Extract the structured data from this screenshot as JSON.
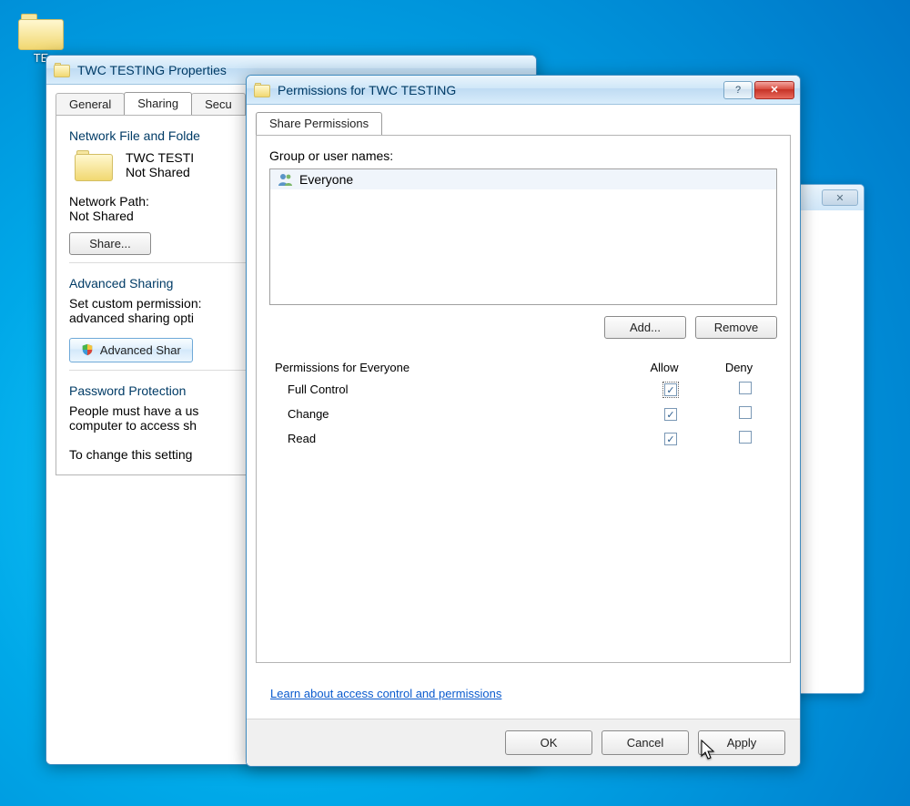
{
  "desktop": {
    "icon_label": "TE"
  },
  "properties_window": {
    "title": "TWC TESTING Properties",
    "tabs": {
      "general": "General",
      "sharing": "Sharing",
      "security": "Secu"
    },
    "section_network": "Network File and Folde",
    "folder_name": "TWC TESTI",
    "folder_status": "Not Shared",
    "network_path_label": "Network Path:",
    "network_path_value": "Not Shared",
    "share_button": "Share...",
    "section_advanced": "Advanced Sharing",
    "advanced_text1": "Set custom permission:",
    "advanced_text2": "advanced sharing opti",
    "advanced_button": "Advanced Shar",
    "section_password": "Password Protection",
    "password_text1": "People must have a us",
    "password_text2": "computer to access sh",
    "password_text3": "To change this setting"
  },
  "permissions_window": {
    "title": "Permissions for TWC TESTING",
    "tab": "Share Permissions",
    "group_label": "Group or user names:",
    "user_item": "Everyone",
    "add_button": "Add...",
    "remove_button": "Remove",
    "perm_header": "Permissions for Everyone",
    "col_allow": "Allow",
    "col_deny": "Deny",
    "perm_full": "Full Control",
    "perm_change": "Change",
    "perm_read": "Read",
    "learn_link": "Learn about access control and permissions",
    "ok": "OK",
    "cancel": "Cancel",
    "apply": "Apply"
  }
}
